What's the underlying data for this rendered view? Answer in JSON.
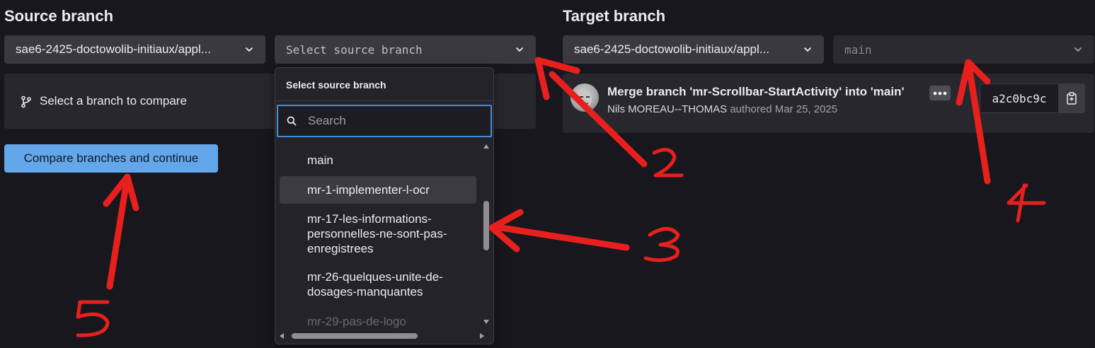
{
  "source": {
    "heading": "Source branch",
    "project_select": "sae6-2425-doctowolib-initiaux/appl...",
    "branch_select_placeholder": "Select source branch",
    "compare_hint": "Select a branch to compare",
    "compare_button": "Compare branches and continue"
  },
  "target": {
    "heading": "Target branch",
    "project_select": "sae6-2425-doctowolib-initiaux/appl...",
    "branch_select": "main",
    "commit": {
      "title": "Merge branch 'mr-Scrollbar-StartActivity' into 'main'",
      "author": "Nils MOREAU--THOMAS",
      "authored_text": "authored Mar 25, 2025",
      "sha": "a2c0bc9c"
    }
  },
  "dropdown": {
    "title": "Select source branch",
    "search_placeholder": "Search",
    "items": [
      {
        "label": "main"
      },
      {
        "label": "mr-1-implementer-l-ocr"
      },
      {
        "label": "mr-17-les-informations-personnelles-ne-sont-pas-enregistrees"
      },
      {
        "label": "mr-26-quelques-unite-de-dosages-manquantes"
      },
      {
        "label": "mr-29-pas-de-logo"
      }
    ]
  },
  "annotations": [
    "2",
    "3",
    "4",
    "5"
  ],
  "colors": {
    "background": "#18171d",
    "primary_button": "#63a6e9",
    "annotation_red": "#e8201d",
    "focus_border": "#428fdc"
  }
}
